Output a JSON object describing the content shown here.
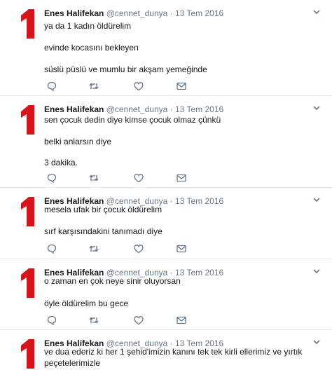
{
  "tweets": [
    {
      "name": "Enes Halifekan",
      "handle": "@cennet_dunya",
      "separator": "·",
      "date": "13 Tem 2016",
      "lines": [
        "ya da 1 kadın öldürelim",
        "evinde kocasını bekleyen",
        "süslü püslü ve mumlu bir akşam yemeğinde"
      ]
    },
    {
      "name": "Enes Halifekan",
      "handle": "@cennet_dunya",
      "separator": "·",
      "date": "13 Tem 2016",
      "lines": [
        "sen çocuk dedin diye kimse çocuk olmaz çünkü",
        "belki anlarsın diye",
        "3 dakika."
      ]
    },
    {
      "name": "Enes Halifekan",
      "handle": "@cennet_dunya",
      "separator": "·",
      "date": "13 Tem 2016",
      "lines": [
        "mesela ufak bir çocuk öldürelim",
        "sırf karşısındakini tanımadı diye"
      ]
    },
    {
      "name": "Enes Halifekan",
      "handle": "@cennet_dunya",
      "separator": "·",
      "date": "13 Tem 2016",
      "lines": [
        "o zaman en çok neye sinir oluyorsan",
        "öyle öldürelim bu gece"
      ]
    },
    {
      "name": "Enes Halifekan",
      "handle": "@cennet_dunya",
      "separator": "·",
      "date": "13 Tem 2016",
      "lines": [
        "ve dua ederiz ki her 1 şehid'imizin kanını tek tek kirli ellerimiz ve yırtık peçetelerimizle"
      ]
    }
  ],
  "icons": {
    "avatar": "red-number-one-icon",
    "menu": "chevron-down-icon",
    "reply": "reply-icon",
    "retweet": "retweet-icon",
    "like": "heart-icon",
    "dm": "envelope-icon"
  },
  "colors": {
    "avatar_red": "#d7141a",
    "muted": "#657786",
    "text": "#14171a",
    "divider": "#e1e8ed"
  }
}
